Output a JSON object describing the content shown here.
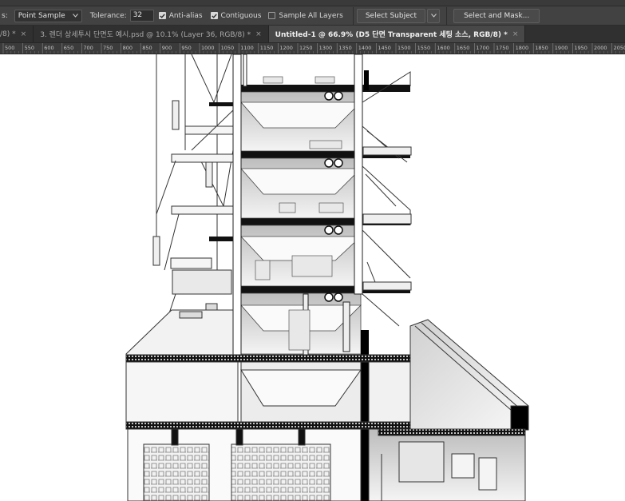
{
  "options_bar": {
    "sample_label": "Point Sample",
    "tolerance_label": "Tolerance:",
    "tolerance_value": "32",
    "anti_alias": {
      "label": "Anti-alias",
      "checked": true
    },
    "contiguous": {
      "label": "Contiguous",
      "checked": true
    },
    "sample_all_layers": {
      "label": "Sample All Layers",
      "checked": false
    },
    "select_subject_label": "Select Subject",
    "select_and_mask_label": "Select and Mask..."
  },
  "tabs": [
    {
      "label": "/8) *",
      "active": false
    },
    {
      "label": "3. 렌더 상세투시 단면도 예시.psd @ 10.1% (Layer 36, RGB/8) *",
      "active": false
    },
    {
      "label": "Untitled-1 @ 66.9% (D5 단면 Transparent 세팅 소스, RGB/8) *",
      "active": true
    }
  ],
  "tab_close_glyph": "×",
  "ruler": {
    "ticks": [
      "500",
      "550",
      "600",
      "650",
      "700",
      "750",
      "800",
      "850",
      "900",
      "950",
      "1000",
      "1050",
      "1100",
      "1150",
      "1200",
      "1250",
      "1300",
      "1350",
      "1400",
      "1450",
      "1500",
      "1550",
      "1600",
      "1650",
      "1700",
      "1750",
      "1800",
      "1850",
      "1900",
      "1950",
      "2000",
      "2050"
    ]
  },
  "icons": {
    "checkbox_check": "check-icon",
    "dropdown": "chevron-down-icon",
    "tab_close": "close-icon"
  },
  "colors": {
    "panel": "#424242",
    "tabbar": "#303030",
    "active_tab": "#484848",
    "ruler": "#3b3b3b",
    "canvas": "#ffffff"
  }
}
